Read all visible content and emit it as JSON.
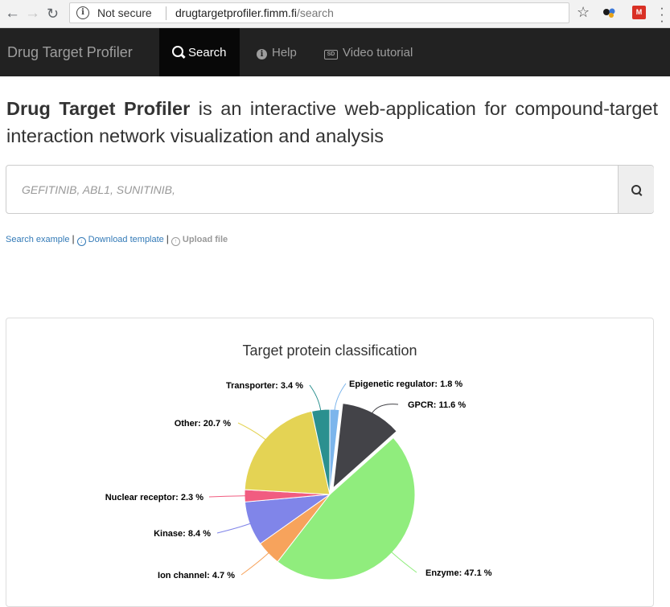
{
  "browser": {
    "security_label": "Not secure",
    "url_host": "drugtargetprofiler.fimm.fi",
    "url_path": "/search",
    "info_icon": "info-circle-icon",
    "back_icon": "arrow-left-icon",
    "forward_icon": "arrow-right-icon",
    "reload_icon": "reload-icon",
    "star_icon": "star-icon",
    "menu_icon": "kebab-menu-icon"
  },
  "navbar": {
    "brand": "Drug Target Profiler",
    "items": [
      {
        "label": "Search",
        "icon": "search-icon",
        "active": true
      },
      {
        "label": "Help",
        "icon": "info-icon",
        "active": false
      },
      {
        "label": "Video tutorial",
        "icon": "video-icon",
        "active": false
      }
    ]
  },
  "intro": {
    "bold": "Drug Target Profiler",
    "text": " is an interactive web-application for compound-target interaction network visualization and analysis"
  },
  "search": {
    "placeholder": "GEFITINIB, ABL1, SUNITINIB,",
    "value": ""
  },
  "links": {
    "example": "Search example",
    "download": "Download template",
    "upload": "Upload file"
  },
  "chart_data": {
    "type": "pie",
    "title": "Target protein classification",
    "slices": [
      {
        "label": "Epigenetic regulator: 1.8 %",
        "value": 1.8,
        "color": "#7cb5ec"
      },
      {
        "label": "GPCR: 11.6 %",
        "value": 11.6,
        "color": "#434348"
      },
      {
        "label": "Enzyme: 47.1 %",
        "value": 47.1,
        "color": "#90ed7d"
      },
      {
        "label": "Ion channel: 4.7 %",
        "value": 4.7,
        "color": "#f7a35c"
      },
      {
        "label": "Kinase: 8.4 %",
        "value": 8.4,
        "color": "#8085e9"
      },
      {
        "label": "Nuclear receptor: 2.3 %",
        "value": 2.3,
        "color": "#f15c80"
      },
      {
        "label": "Other: 20.7 %",
        "value": 20.7,
        "color": "#e4d354"
      },
      {
        "label": "Transporter: 3.4 %",
        "value": 3.4,
        "color": "#2b908f"
      }
    ]
  }
}
